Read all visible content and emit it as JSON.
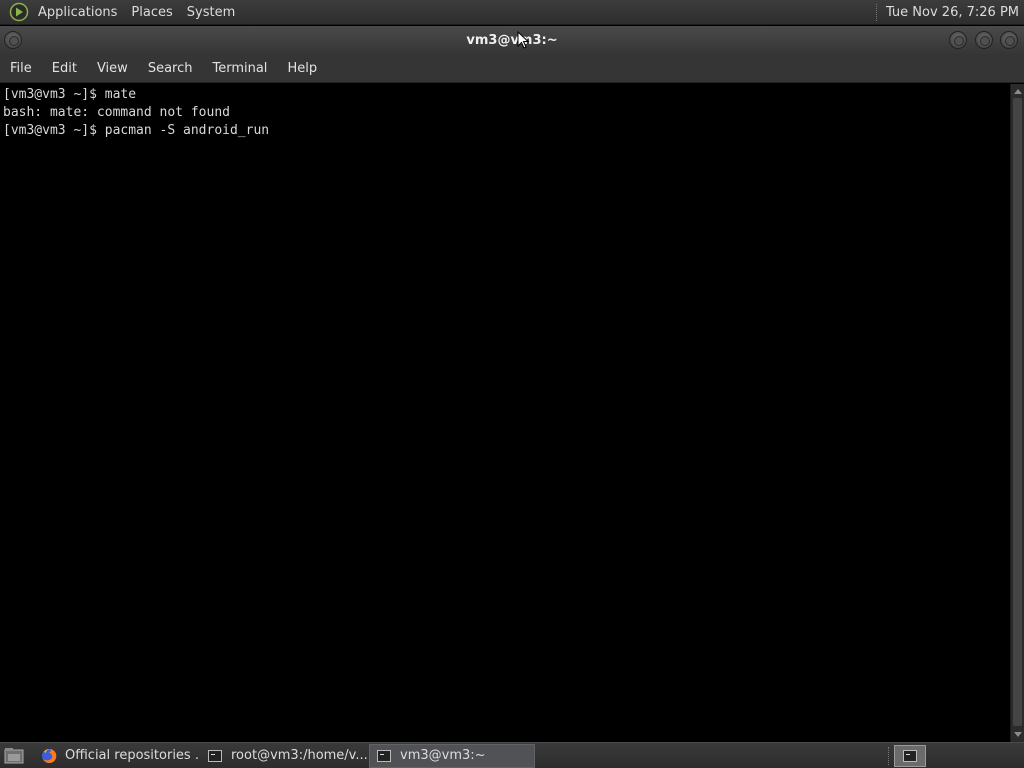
{
  "top_panel": {
    "menus": [
      "Applications",
      "Places",
      "System"
    ],
    "clock": "Tue Nov 26,  7:26 PM",
    "logo_icon": "mate-logo-icon"
  },
  "window": {
    "title": "vm3@vm3:~"
  },
  "menubar": [
    "File",
    "Edit",
    "View",
    "Search",
    "Terminal",
    "Help"
  ],
  "terminal": {
    "lines": [
      "[vm3@vm3 ~]$ mate",
      "bash: mate: command not found",
      "[vm3@vm3 ~]$ pacman -S android_run"
    ]
  },
  "taskbar": {
    "tasks": [
      {
        "label": "Official repositories ...",
        "icon": "firefox-icon",
        "active": false
      },
      {
        "label": "root@vm3:/home/v...",
        "icon": "terminal-icon",
        "active": false
      },
      {
        "label": "vm3@vm3:~",
        "icon": "terminal-icon",
        "active": true
      }
    ]
  },
  "colors": {
    "panel_bg": "#333333",
    "terminal_bg": "#000000",
    "terminal_fg": "#d8d8d8",
    "active_task_bg": "#505256"
  }
}
